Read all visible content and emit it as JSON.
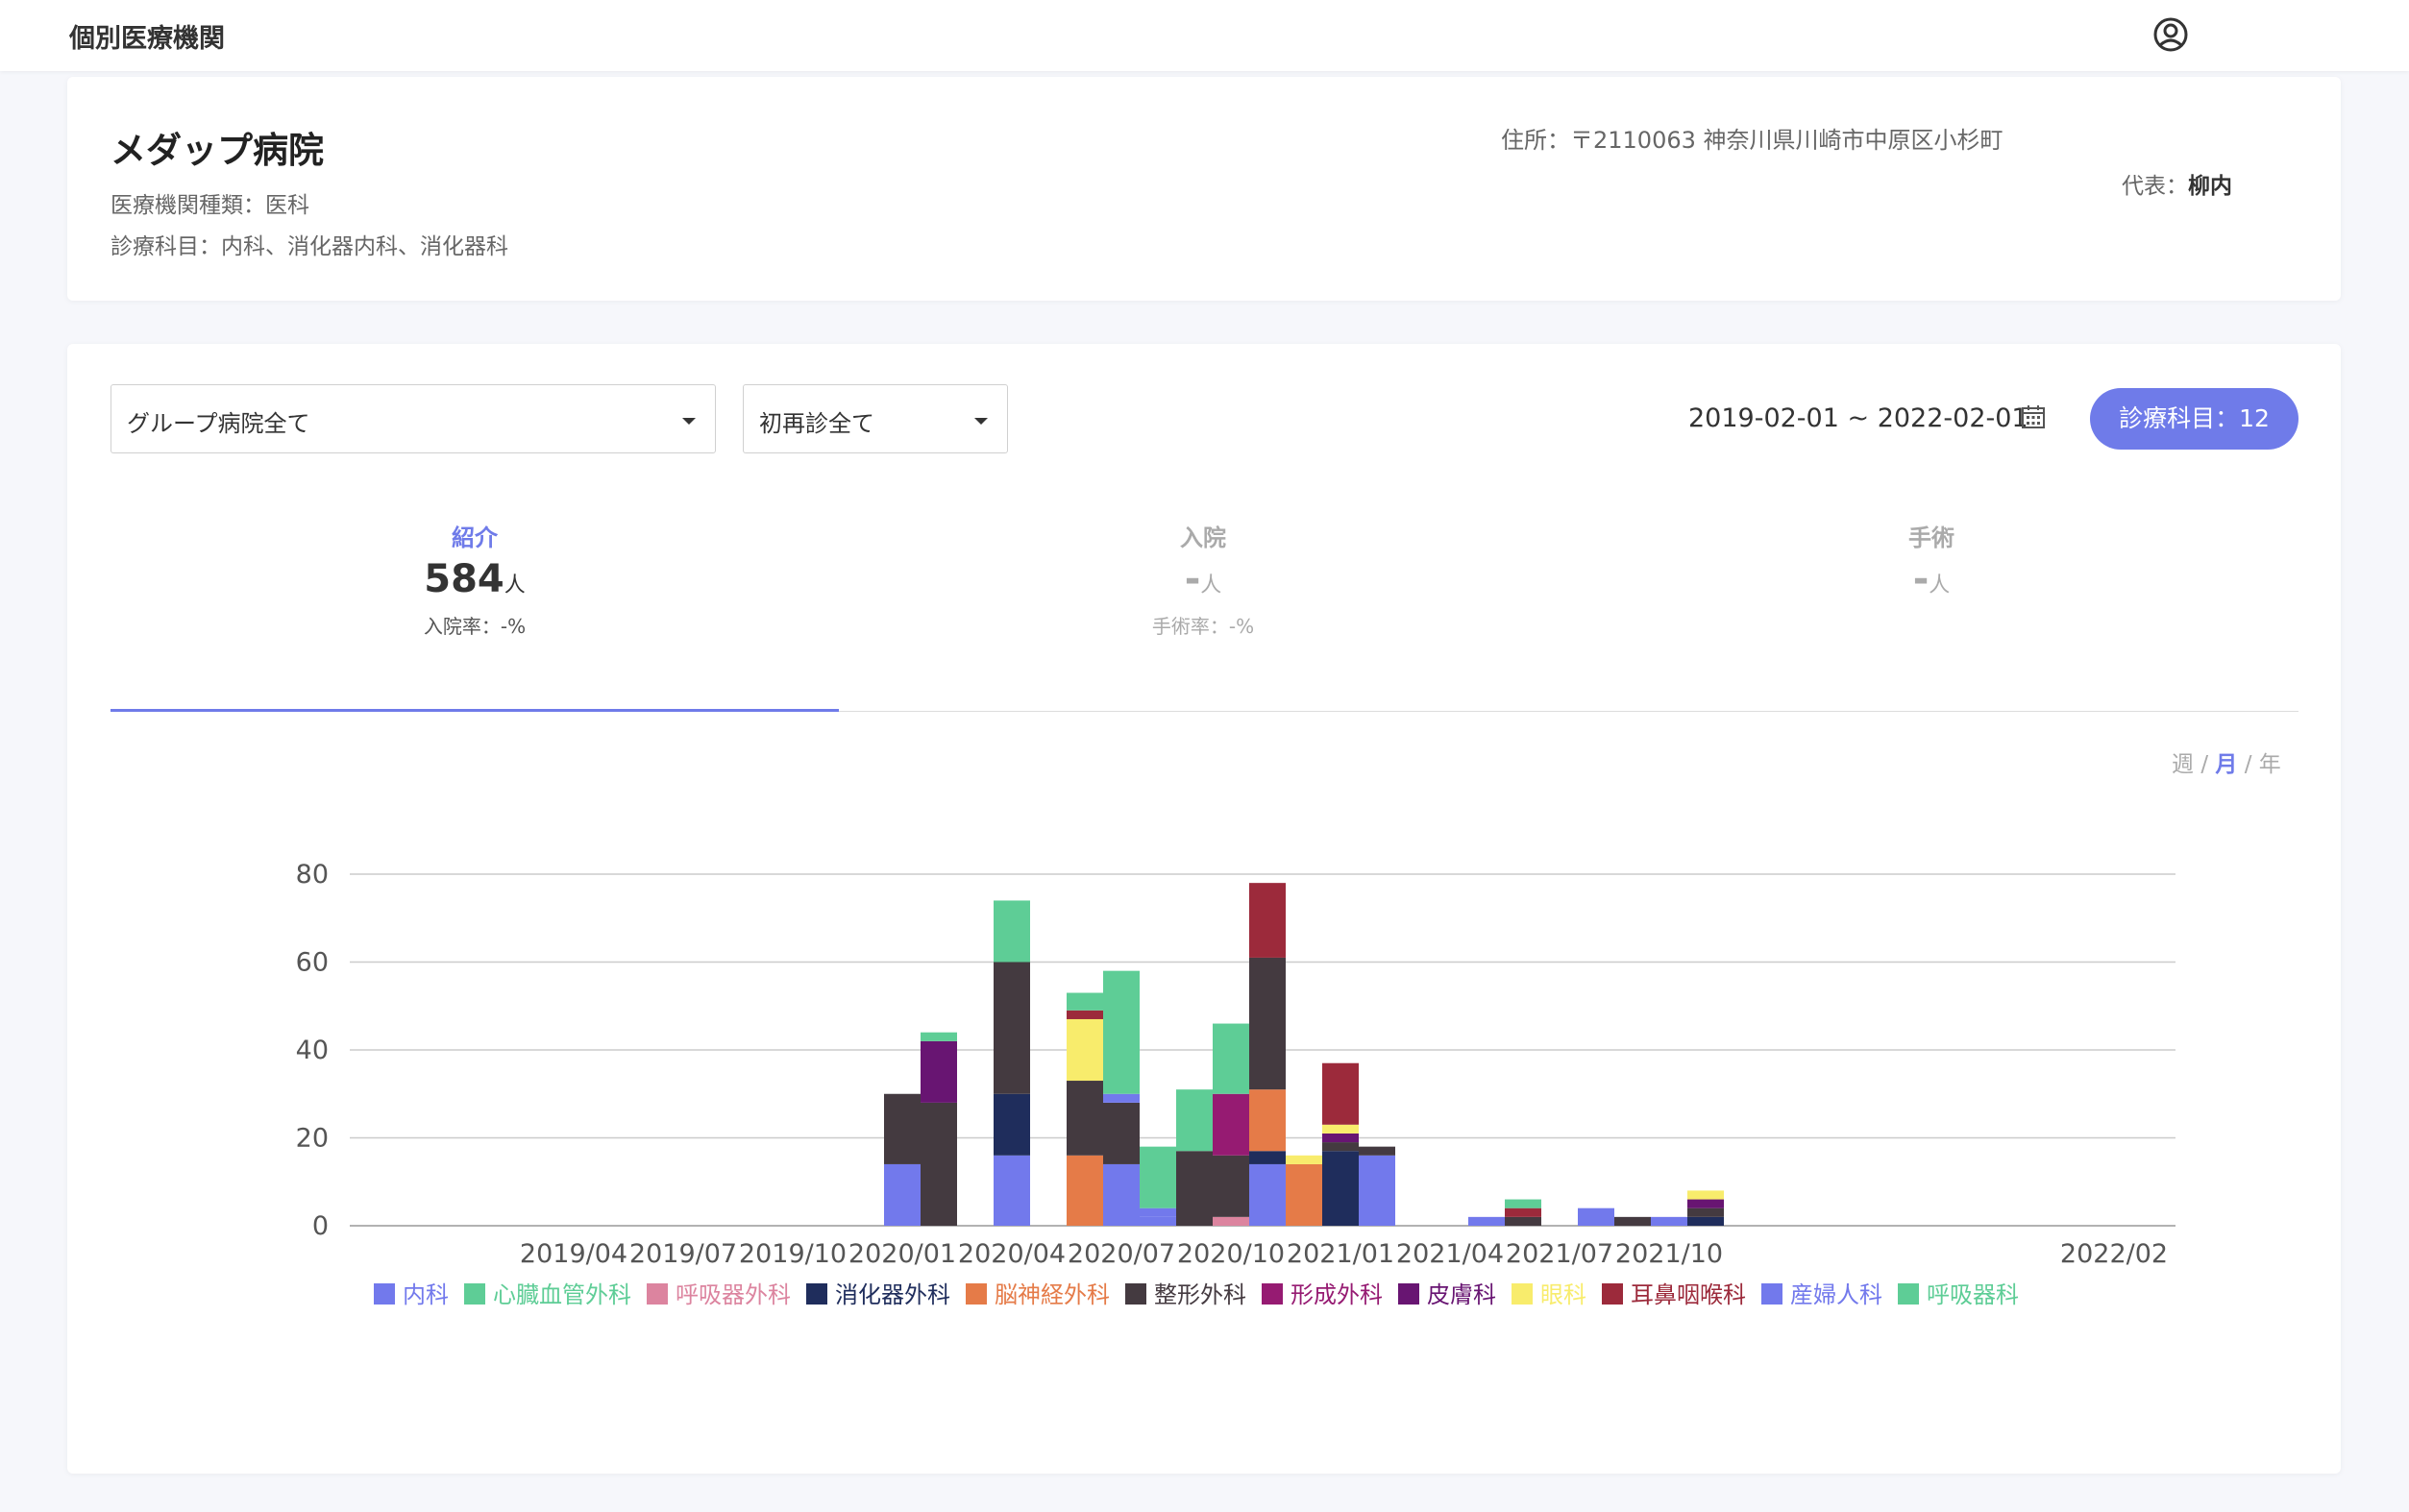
{
  "header": {
    "title": "個別医療機関",
    "user_icon": "user-circle-icon"
  },
  "hospital": {
    "name": "メダップ病院",
    "type_line": "医療機関種類：医科",
    "depts_line": "診療科目：内科、消化器内科、消化器科",
    "address": "住所：〒2110063 神奈川県川崎市中原区小杉町",
    "rep_label": "代表：",
    "rep_name": "柳内"
  },
  "filters": {
    "group": "グループ病院全て",
    "visit": "初再診全て",
    "date_range": "2019-02-01 ~ 2022-02-01",
    "dept_button": "診療科目：12"
  },
  "tabs": [
    {
      "label": "紹介",
      "value": "584",
      "unit": "人",
      "sub": "入院率：-%"
    },
    {
      "label": "入院",
      "value": "-",
      "unit": "人",
      "sub": "手術率：-%"
    },
    {
      "label": "手術",
      "value": "-",
      "unit": "人",
      "sub": ""
    }
  ],
  "period": {
    "week": "週",
    "sep": "/",
    "month": "月",
    "year": "年"
  },
  "chart_data": {
    "type": "bar",
    "stacked": true,
    "ylim": [
      0,
      80
    ],
    "yticks": [
      0,
      20,
      40,
      60,
      80
    ],
    "xticks": [
      {
        "label": "2019/04",
        "i": 2
      },
      {
        "label": "2019/07",
        "i": 5
      },
      {
        "label": "2019/10",
        "i": 8
      },
      {
        "label": "2020/01",
        "i": 11
      },
      {
        "label": "2020/04",
        "i": 14
      },
      {
        "label": "2020/07",
        "i": 17
      },
      {
        "label": "2020/10",
        "i": 20
      },
      {
        "label": "2021/01",
        "i": 23
      },
      {
        "label": "2021/04",
        "i": 26
      },
      {
        "label": "2021/07",
        "i": 29
      },
      {
        "label": "2021/10",
        "i": 32
      },
      {
        "label": "2022/02",
        "i": 36
      }
    ],
    "categories": [
      "2019/02",
      "2019/03",
      "2019/04",
      "2019/05",
      "2019/06",
      "2019/07",
      "2019/08",
      "2019/09",
      "2019/10",
      "2019/11",
      "2019/12",
      "2020/01",
      "2020/02",
      "2020/03",
      "2020/04",
      "2020/05",
      "2020/06",
      "2020/07",
      "2020/08",
      "2020/09",
      "2020/10",
      "2020/11",
      "2020/12",
      "2021/01",
      "2021/02",
      "2021/03",
      "2021/04",
      "2021/05",
      "2021/06",
      "2021/07",
      "2021/08",
      "2021/09",
      "2021/10",
      "2021/11",
      "2021/12",
      "2022/01",
      "2022/02"
    ],
    "series": [
      {
        "name": "内科",
        "color": "#7279ec",
        "values": [
          0,
          0,
          0,
          0,
          0,
          0,
          0,
          0,
          0,
          0,
          0,
          14,
          0,
          0,
          16,
          0,
          0,
          14,
          2,
          0,
          0,
          14,
          0,
          0,
          16,
          0,
          0,
          2,
          0,
          0,
          4,
          0,
          0,
          0,
          0,
          0,
          0
        ]
      },
      {
        "name": "心臓血管外科",
        "color": "#5ecd96",
        "values": [
          0,
          0,
          0,
          0,
          0,
          0,
          0,
          0,
          0,
          0,
          0,
          0,
          0,
          0,
          0,
          0,
          0,
          0,
          0,
          0,
          0,
          0,
          0,
          0,
          0,
          0,
          0,
          0,
          0,
          0,
          0,
          0,
          0,
          0,
          0,
          0,
          0
        ]
      },
      {
        "name": "呼吸器外科",
        "color": "#dc849f",
        "values": [
          0,
          0,
          0,
          0,
          0,
          0,
          0,
          0,
          0,
          0,
          0,
          0,
          0,
          0,
          0,
          0,
          0,
          0,
          0,
          0,
          2,
          0,
          0,
          0,
          0,
          0,
          0,
          0,
          0,
          0,
          0,
          0,
          0,
          0,
          0,
          0,
          0
        ]
      },
      {
        "name": "消化器外科",
        "color": "#1f2d5c",
        "values": [
          0,
          0,
          0,
          0,
          0,
          0,
          0,
          0,
          0,
          0,
          0,
          0,
          0,
          0,
          14,
          0,
          0,
          0,
          0,
          0,
          0,
          3,
          0,
          17,
          0,
          0,
          0,
          0,
          0,
          0,
          0,
          0,
          0,
          2,
          0,
          0,
          0
        ]
      },
      {
        "name": "脳神経外科",
        "color": "#e57b48",
        "values": [
          0,
          0,
          0,
          0,
          0,
          0,
          0,
          0,
          0,
          0,
          0,
          0,
          0,
          0,
          0,
          0,
          16,
          0,
          0,
          0,
          0,
          14,
          14,
          0,
          0,
          0,
          0,
          0,
          0,
          0,
          0,
          0,
          0,
          0,
          0,
          0,
          0
        ]
      },
      {
        "name": "整形外科",
        "color": "#443a40",
        "values": [
          0,
          0,
          0,
          0,
          0,
          0,
          0,
          0,
          0,
          0,
          0,
          16,
          28,
          0,
          30,
          0,
          17,
          14,
          0,
          17,
          14,
          30,
          0,
          2,
          2,
          0,
          0,
          0,
          2,
          0,
          0,
          2,
          0,
          2,
          0,
          0,
          0
        ]
      },
      {
        "name": "形成外科",
        "color": "#961b72",
        "values": [
          0,
          0,
          0,
          0,
          0,
          0,
          0,
          0,
          0,
          0,
          0,
          0,
          0,
          0,
          0,
          0,
          0,
          0,
          0,
          0,
          14,
          0,
          0,
          0,
          0,
          0,
          0,
          0,
          0,
          0,
          0,
          0,
          0,
          0,
          0,
          0,
          0
        ]
      },
      {
        "name": "皮膚科",
        "color": "#681572",
        "values": [
          0,
          0,
          0,
          0,
          0,
          0,
          0,
          0,
          0,
          0,
          0,
          0,
          14,
          0,
          0,
          0,
          0,
          0,
          0,
          0,
          0,
          0,
          0,
          2,
          0,
          0,
          0,
          0,
          0,
          0,
          0,
          0,
          0,
          2,
          0,
          0,
          0
        ]
      },
      {
        "name": "眼科",
        "color": "#f8ec6c",
        "values": [
          0,
          0,
          0,
          0,
          0,
          0,
          0,
          0,
          0,
          0,
          0,
          0,
          0,
          0,
          0,
          0,
          14,
          0,
          0,
          0,
          0,
          0,
          2,
          2,
          0,
          0,
          0,
          0,
          0,
          0,
          0,
          0,
          0,
          2,
          0,
          0,
          0
        ]
      },
      {
        "name": "耳鼻咽喉科",
        "color": "#9c2a3b",
        "values": [
          0,
          0,
          0,
          0,
          0,
          0,
          0,
          0,
          0,
          0,
          0,
          0,
          0,
          0,
          0,
          0,
          2,
          0,
          0,
          0,
          0,
          17,
          0,
          14,
          0,
          0,
          0,
          0,
          2,
          0,
          0,
          0,
          0,
          0,
          0,
          0,
          0
        ]
      },
      {
        "name": "産婦人科",
        "color": "#7279ec",
        "values": [
          0,
          0,
          0,
          0,
          0,
          0,
          0,
          0,
          0,
          0,
          0,
          0,
          0,
          0,
          0,
          0,
          0,
          2,
          2,
          0,
          0,
          0,
          0,
          0,
          0,
          0,
          0,
          0,
          0,
          0,
          0,
          0,
          2,
          0,
          0,
          0,
          0
        ]
      },
      {
        "name": "呼吸器科",
        "color": "#5ecd96",
        "values": [
          0,
          0,
          0,
          0,
          0,
          0,
          0,
          0,
          0,
          0,
          0,
          0,
          2,
          0,
          14,
          0,
          4,
          28,
          14,
          14,
          16,
          0,
          0,
          0,
          0,
          0,
          0,
          0,
          2,
          0,
          0,
          0,
          0,
          0,
          0,
          0,
          0
        ]
      }
    ],
    "legend_position": "bottom",
    "grid": true
  }
}
